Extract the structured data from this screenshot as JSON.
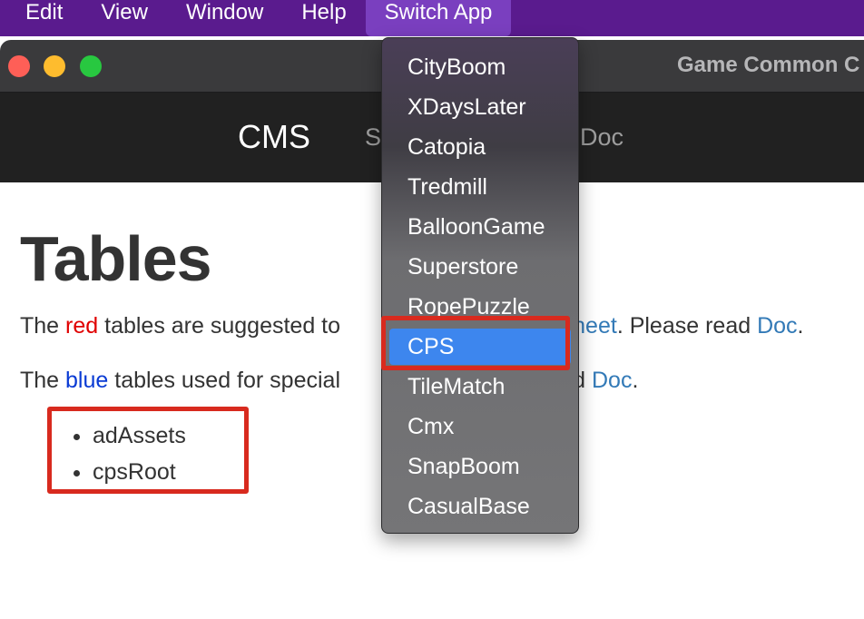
{
  "menubar": {
    "items": [
      "Edit",
      "View",
      "Window",
      "Help",
      "Switch App"
    ]
  },
  "window": {
    "title": "Game Common C"
  },
  "navbar": {
    "brand": "CMS",
    "link_partial_left": "S",
    "link_doc": "Doc"
  },
  "content": {
    "title": "Tables",
    "p1": {
      "prefix": "The ",
      "red_word": "red",
      "middle": " tables are suggested to",
      "link_gsheet": "GSheet",
      "after": ". Please read ",
      "link_doc": "Doc",
      "end": "."
    },
    "p2": {
      "prefix": "The ",
      "blue_word": "blue",
      "middle": " tables used for special",
      "gap_text": "read ",
      "link_doc": "Doc",
      "end": "."
    },
    "tables": [
      "adAssets",
      "cpsRoot"
    ]
  },
  "dropdown": {
    "items": [
      "CityBoom",
      "XDaysLater",
      "Catopia",
      "Tredmill",
      "BalloonGame",
      "Superstore",
      "RopePuzzle",
      "CPS",
      "TileMatch",
      "Cmx",
      "SnapBoom",
      "CasualBase"
    ],
    "selected": "CPS"
  },
  "colors": {
    "menubar": "#5a1b8e",
    "highlight_box": "#d82a1e",
    "selected_item": "#3d86ee",
    "red_word": "#e00000",
    "blue_word": "#0a3bd4",
    "link": "#337ab7"
  }
}
